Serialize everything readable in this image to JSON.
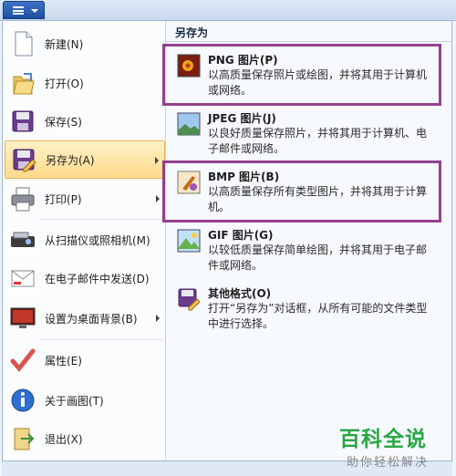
{
  "left_menu": {
    "items": [
      {
        "label": "新建(N)",
        "icon": "new-file-icon"
      },
      {
        "label": "打开(O)",
        "icon": "folder-open-icon"
      },
      {
        "label": "保存(S)",
        "icon": "floppy-disk-icon"
      },
      {
        "label": "另存为(A)",
        "icon": "save-as-icon"
      },
      {
        "label": "打印(P)",
        "icon": "printer-icon"
      },
      {
        "label": "从扫描仪或照相机(M)",
        "icon": "scanner-icon"
      },
      {
        "label": "在电子邮件中发送(D)",
        "icon": "email-icon"
      },
      {
        "label": "设置为桌面背景(B)",
        "icon": "desktop-background-icon"
      },
      {
        "label": "属性(E)",
        "icon": "checkmark-icon"
      },
      {
        "label": "关于画图(T)",
        "icon": "info-icon"
      },
      {
        "label": "退出(X)",
        "icon": "exit-icon"
      }
    ]
  },
  "save_as_panel": {
    "title": "另存为",
    "options": [
      {
        "title": "PNG 图片(P)",
        "desc": "以高质量保存照片或绘图，并将其用于计算机或网络。",
        "icon": "png-image-icon"
      },
      {
        "title": "JPEG 图片(J)",
        "desc": "以良好质量保存照片，并将其用于计算机、电子邮件或网络。",
        "icon": "jpeg-image-icon"
      },
      {
        "title": "BMP 图片(B)",
        "desc": "以高质量保存所有类型图片，并将其用于计算机。",
        "icon": "bmp-image-icon"
      },
      {
        "title": "GIF 图片(G)",
        "desc": "以较低质量保存简单绘图，并将其用于电子邮件或网络。",
        "icon": "gif-image-icon"
      },
      {
        "title": "其他格式(O)",
        "desc": "打开“另存为”对话框，从所有可能的文件类型中进行选择。",
        "icon": "other-formats-icon"
      }
    ]
  },
  "watermark": {
    "main": "百科全说",
    "sub": "助你轻松解决"
  },
  "colors": {
    "highlight_border": "#93408f",
    "selected_bg": "#ffd98a",
    "watermark_green": "#28a745"
  }
}
